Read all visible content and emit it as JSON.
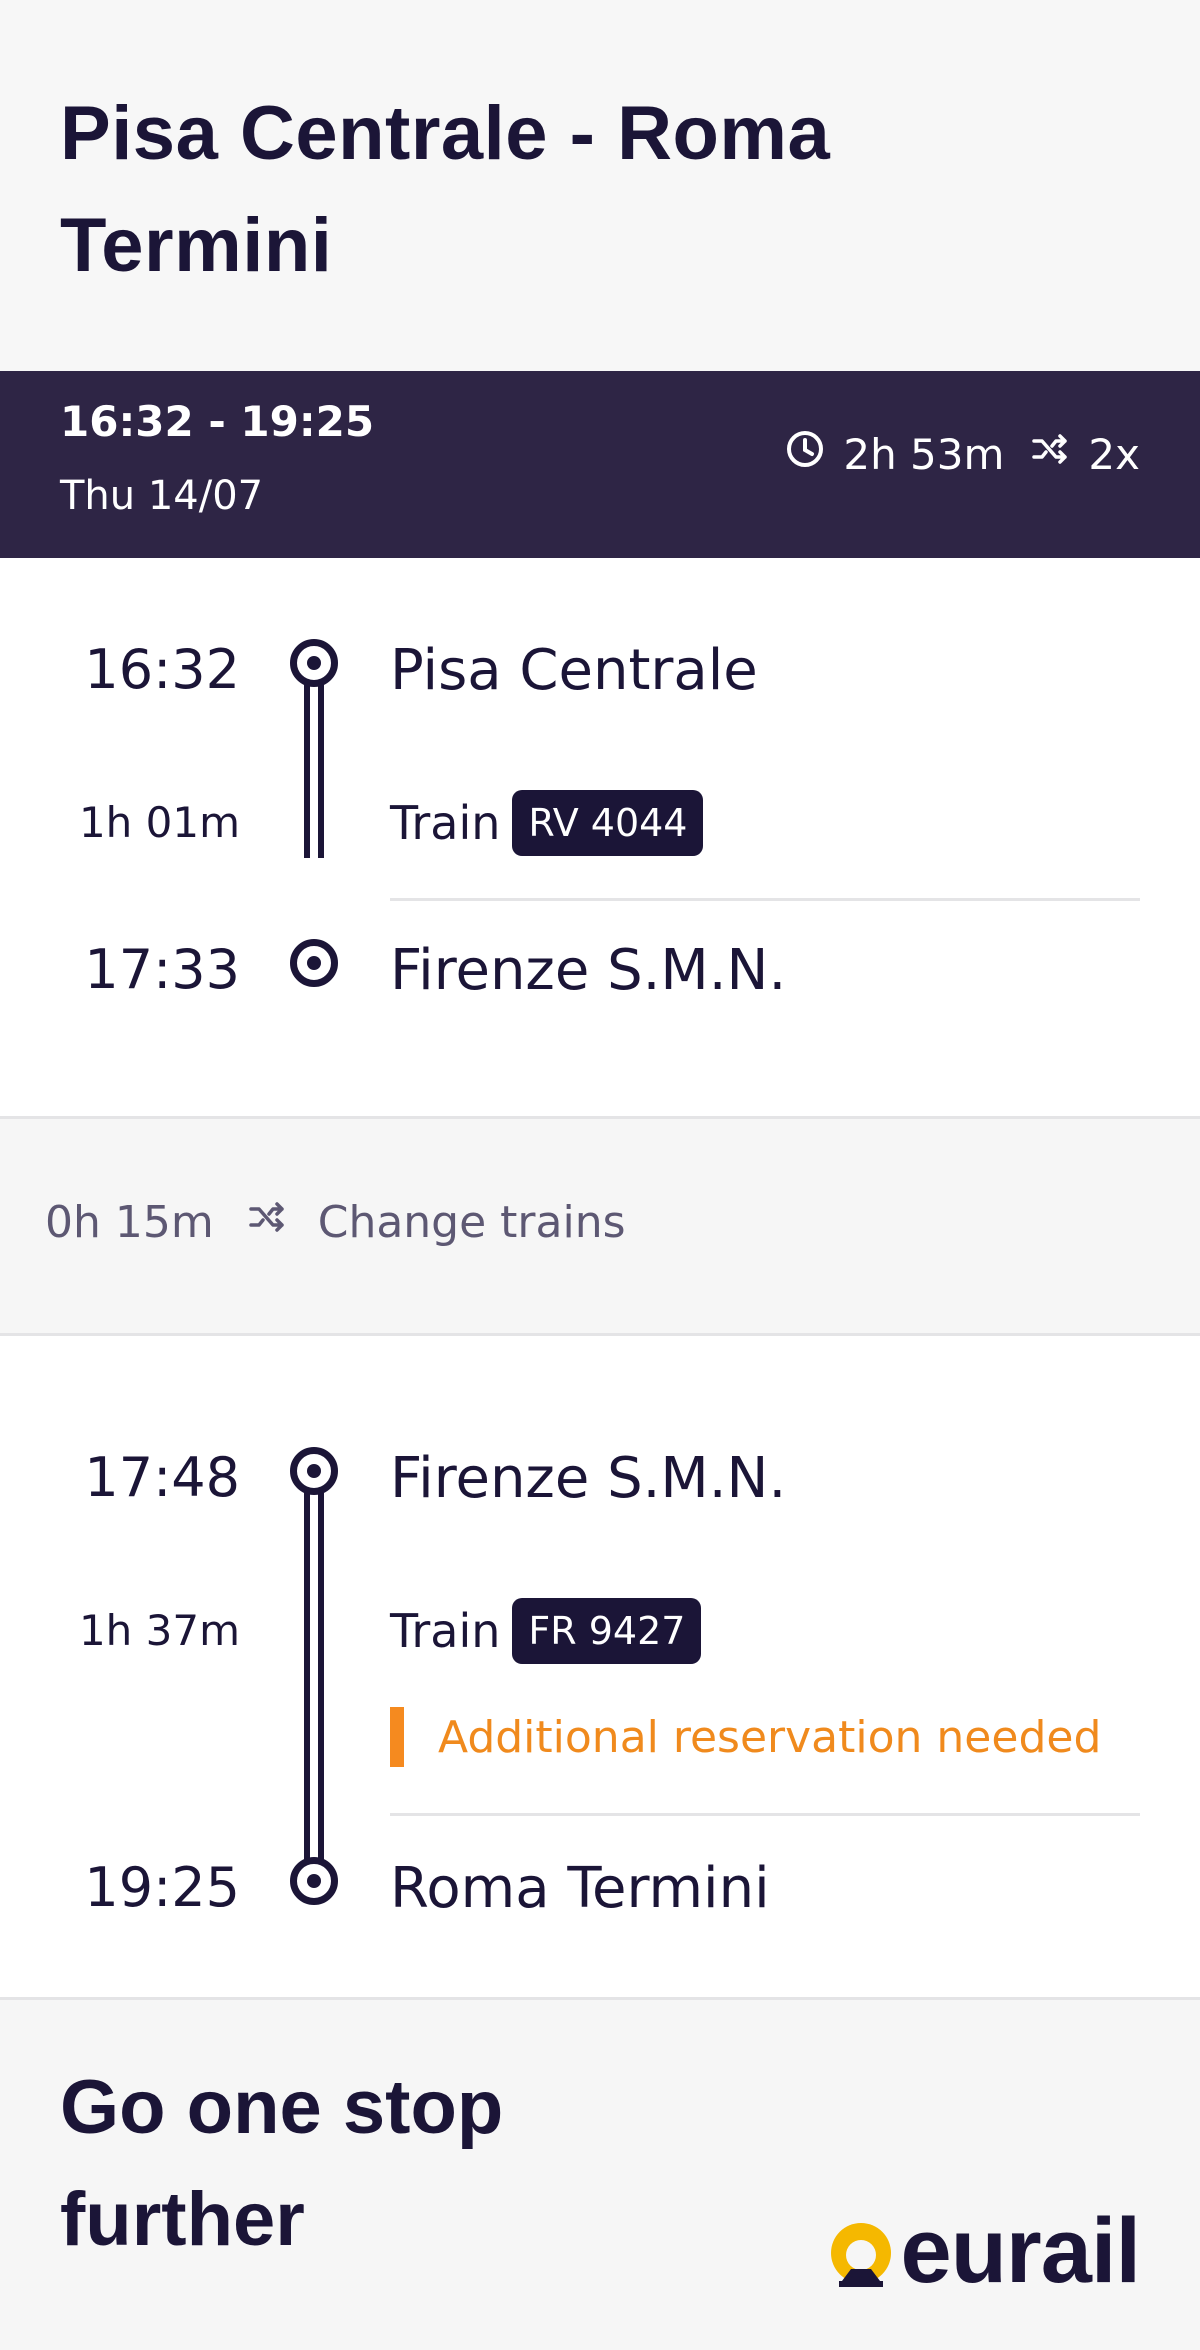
{
  "header": {
    "title": "Pisa Centrale - Roma Termini"
  },
  "summary": {
    "times": "16:32 - 19:25",
    "date": "Thu 14/07",
    "duration": "2h 53m",
    "changes": "2x",
    "icons": [
      "clock-icon",
      "shuffle-icon"
    ]
  },
  "legs": [
    {
      "depart_time": "16:32",
      "depart_station": "Pisa Centrale",
      "duration": "1h 01m",
      "mode": "Train",
      "train_number": "RV 4044",
      "arrive_time": "17:33",
      "arrive_station": "Firenze S.M.N."
    },
    {
      "depart_time": "17:48",
      "depart_station": "Firenze S.M.N.",
      "duration": "1h 37m",
      "mode": "Train",
      "train_number": "FR 9427",
      "notice": "Additional reservation needed",
      "arrive_time": "19:25",
      "arrive_station": "Roma Termini"
    }
  ],
  "transfer": {
    "duration": "0h 15m",
    "label": "Change trains"
  },
  "footer": {
    "promo": "Go one stop further",
    "brand": "eurail"
  },
  "colors": {
    "primary": "#1b1537",
    "summary_bg": "#2e2545",
    "warning": "#f58a1f",
    "brand_accent": "#f5b800"
  }
}
